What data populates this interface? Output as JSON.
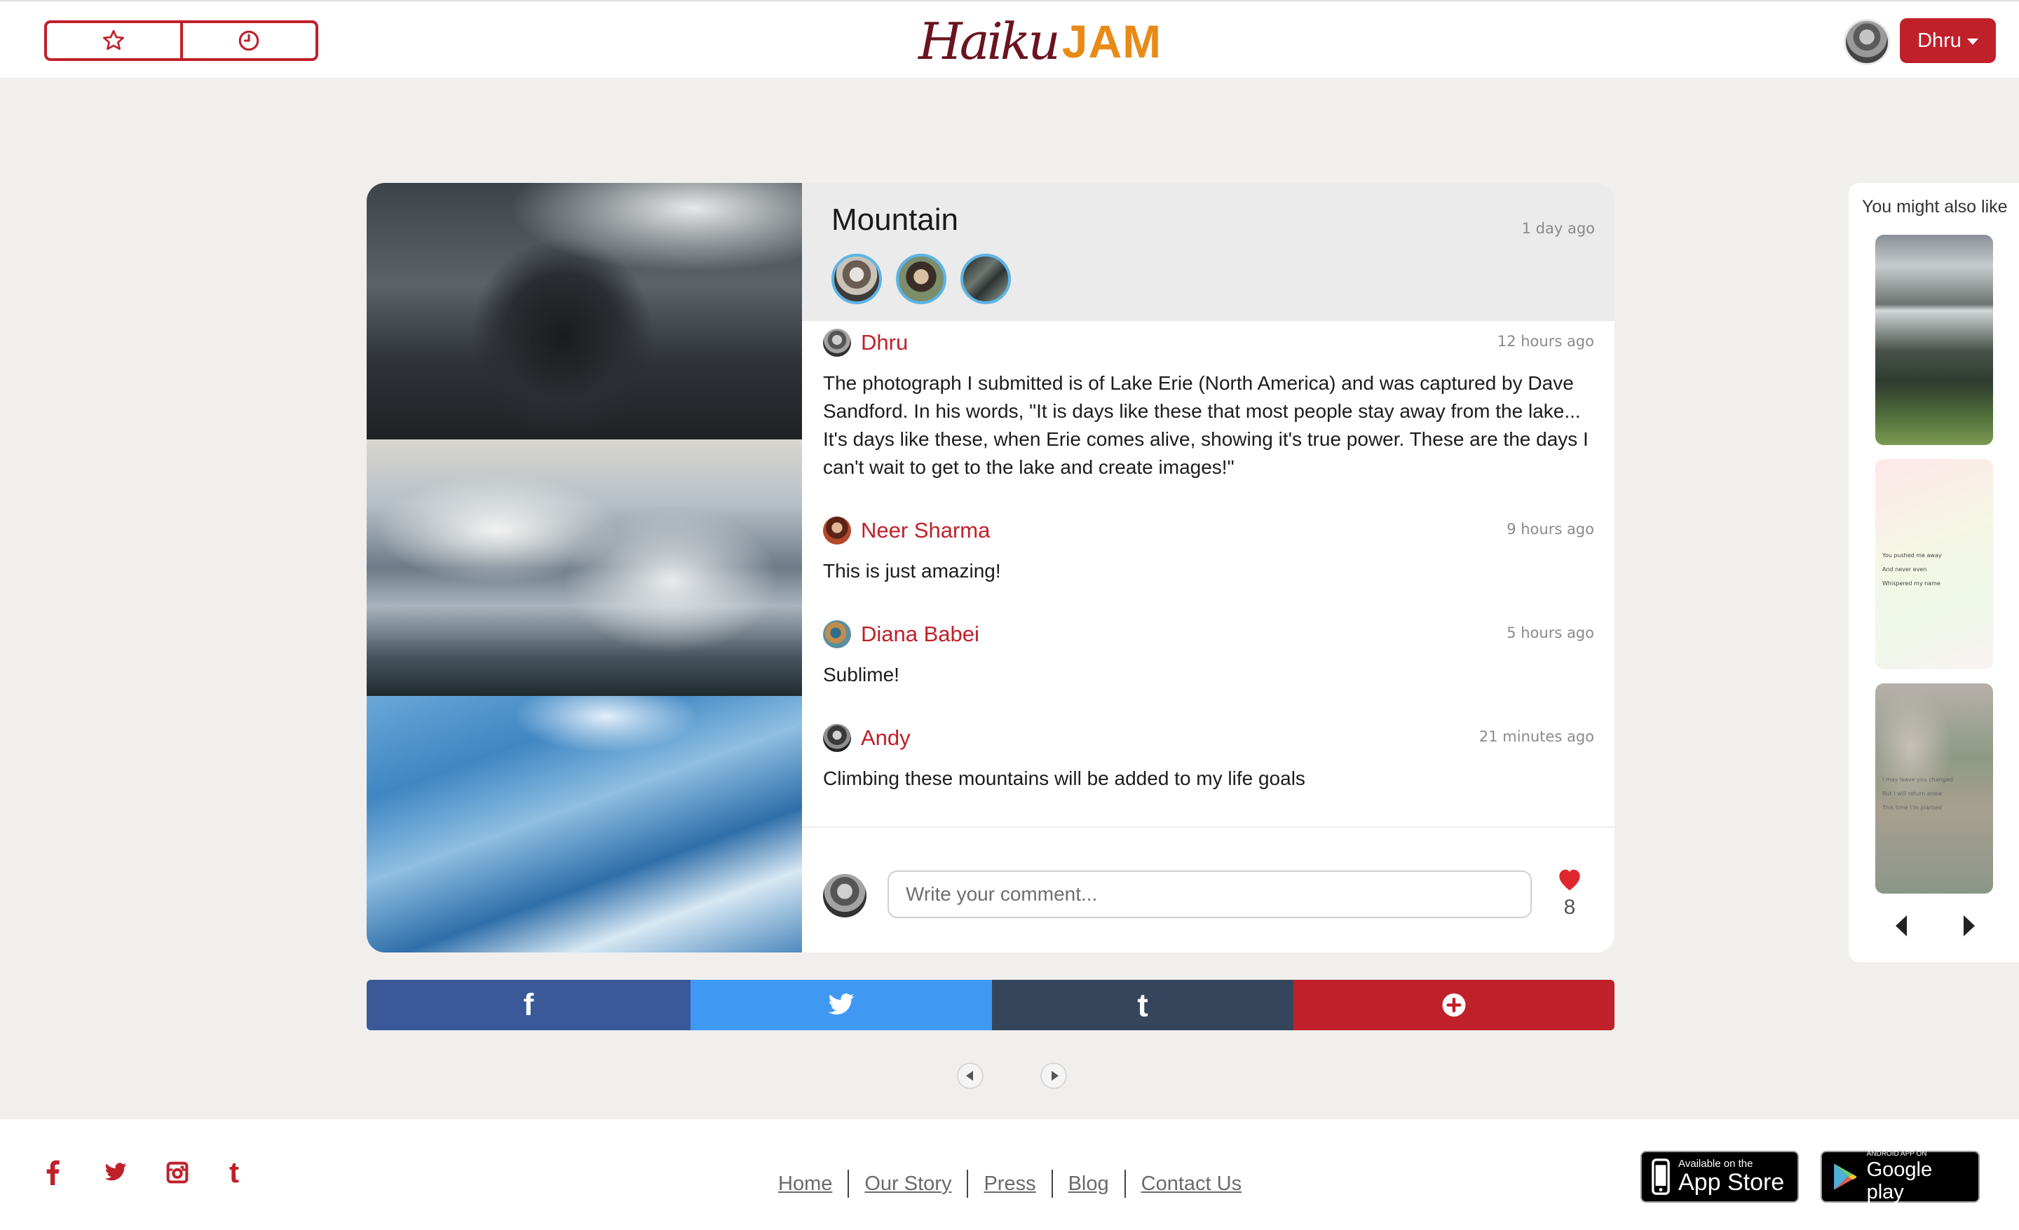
{
  "header": {
    "logo_part1": "Haiku",
    "logo_part2": "JAM",
    "user_name": "Dhru"
  },
  "post": {
    "title": "Mountain",
    "time": "1 day ago",
    "comments": [
      {
        "name": "Dhru",
        "time": "12 hours ago",
        "text": "The photograph I submitted is of Lake Erie (North America) and was captured by Dave Sandford. In his words, \"It is days like these that most people stay away from the lake... It's days like these, when Erie comes alive, showing it's true power. These are the days I can't wait to get to the lake and create images!\""
      },
      {
        "name": "Neer Sharma",
        "time": "9 hours ago",
        "text": "This is just amazing!"
      },
      {
        "name": "Diana Babei",
        "time": "5 hours ago",
        "text": "Sublime!"
      },
      {
        "name": "Andy",
        "time": "21 minutes ago",
        "text": "Climbing these mountains will be added to my life goals"
      }
    ],
    "comment_placeholder": "Write your comment...",
    "like_count": "8"
  },
  "share": {
    "facebook_glyph": "f",
    "tumblr_glyph": "t"
  },
  "sidebar": {
    "title": "You might also like",
    "thumb2_text": "You pushed me away\nAnd never even\nWhispered my name",
    "thumb3_text": "I may leave you changed\nBut I will return anew\nThis time I'm planted"
  },
  "footer": {
    "links": [
      "Home",
      "Our Story",
      "Press",
      "Blog",
      "Contact Us"
    ],
    "appstore_small": "Available on the",
    "appstore_big": "App Store",
    "gplay_small": "ANDROID APP ON",
    "gplay_big": "Google play",
    "tumblr_glyph": "t"
  },
  "colors": {
    "brand_red": "#c0202a",
    "logo_dark": "#6b1420",
    "logo_orange": "#e98a17",
    "facebook": "#3b5998",
    "twitter": "#3f99f3",
    "tumblr": "#35465c"
  },
  "icons": [
    "star-icon",
    "clock-icon",
    "caret-down-icon",
    "heart-icon",
    "facebook-icon",
    "twitter-icon",
    "tumblr-icon",
    "plus-circle-icon",
    "instagram-icon",
    "apple-icon",
    "google-play-icon"
  ]
}
